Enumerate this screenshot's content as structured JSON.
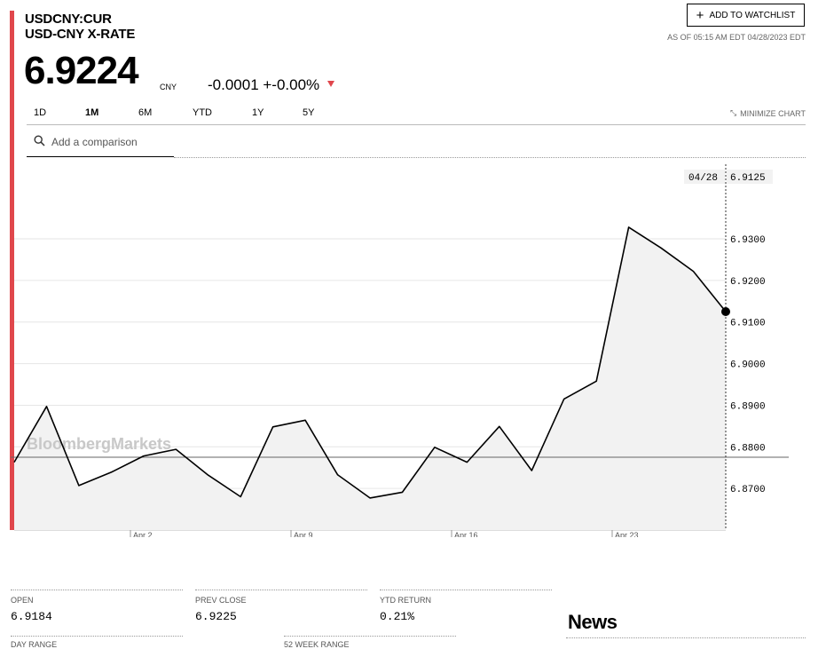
{
  "header": {
    "ticker": "USDCNY:CUR",
    "name": "USD-CNY X-RATE",
    "price": "6.9224",
    "currency": "CNY",
    "change": "-0.0001 +-0.00%",
    "change_direction": "down",
    "watchlist_label": "ADD TO WATCHLIST",
    "as_of": "AS OF 05:15 AM EDT 04/28/2023 EDT"
  },
  "range_tabs": [
    "1D",
    "1M",
    "6M",
    "YTD",
    "1Y",
    "5Y"
  ],
  "active_tab": "1M",
  "minimize_label": "MINIMIZE CHART",
  "comparison_placeholder": "Add a comparison",
  "watermark": "BloombergMarkets",
  "colors": {
    "accent": "#e0474c",
    "line": "#000000",
    "area": "#f2f2f2"
  },
  "chart_data": {
    "type": "area",
    "x": [
      "03/29",
      "03/30",
      "03/31",
      "04/03",
      "04/04",
      "04/05",
      "04/06",
      "04/07",
      "04/10",
      "04/11",
      "04/12",
      "04/13",
      "04/14",
      "04/17",
      "04/18",
      "04/19",
      "04/20",
      "04/21",
      "04/24",
      "04/25",
      "04/26",
      "04/27",
      "04/28"
    ],
    "y": [
      6.8763,
      6.8897,
      6.8707,
      6.8739,
      6.8778,
      6.8794,
      6.8732,
      6.868,
      6.8848,
      6.8864,
      6.8733,
      6.8677,
      6.8691,
      6.8799,
      6.8763,
      6.8849,
      6.8743,
      6.8915,
      6.8958,
      6.9328,
      6.9278,
      6.9222,
      6.9125
    ],
    "x_ticks": [
      "Apr 2",
      "Apr 9",
      "Apr 16",
      "Apr 23"
    ],
    "y_ticks": [
      "6.9300",
      "6.9200",
      "6.9100",
      "6.9000",
      "6.8900",
      "6.8800",
      "6.8700"
    ],
    "ylim": [
      6.86,
      6.949
    ],
    "baseline": 6.86,
    "hover": {
      "date": "04/28",
      "value": "6.9125"
    }
  },
  "stats": [
    {
      "label": "OPEN",
      "value": "6.9184"
    },
    {
      "label": "PREV CLOSE",
      "value": "6.9225"
    },
    {
      "label": "YTD RETURN",
      "value": "0.21%"
    }
  ],
  "stats_row2": [
    "DAY RANGE",
    "52 WEEK RANGE"
  ],
  "news_title": "News"
}
